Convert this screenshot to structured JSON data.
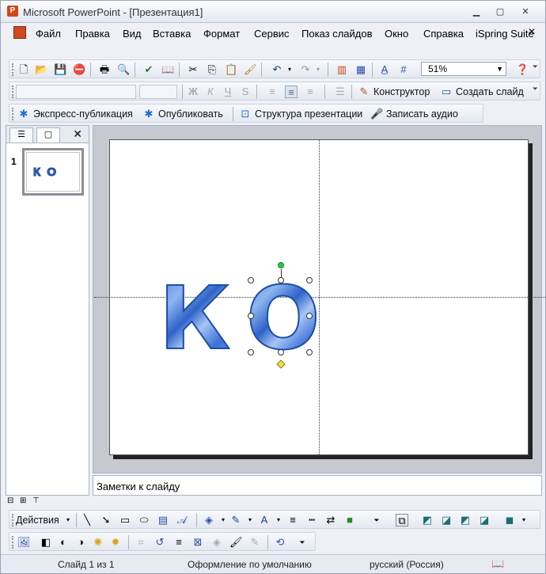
{
  "window": {
    "title": "Microsoft PowerPoint - [Презентация1]"
  },
  "menu": [
    "Файл",
    "Правка",
    "Вид",
    "Вставка",
    "Формат",
    "Сервис",
    "Показ слайдов",
    "Окно",
    "Справка",
    "iSpring Suite"
  ],
  "standard_toolbar": {
    "zoom": "51%"
  },
  "formatting_toolbar": {
    "design_label": "Конструктор",
    "new_slide_label": "Создать слайд"
  },
  "ispring_toolbar": {
    "quick_publish": "Экспресс-публикация",
    "publish": "Опубликовать",
    "structure": "Структура презентации",
    "record_audio": "Записать аудио"
  },
  "slides_pane": {
    "slide_number": "1",
    "thumb_text": "К О"
  },
  "slide": {
    "letter1": "К",
    "letter2": "О"
  },
  "notes": {
    "placeholder": "Заметки к слайду"
  },
  "drawing_toolbar": {
    "actions_label": "Действия"
  },
  "status": {
    "slide_info": "Слайд 1 из 1",
    "design": "Оформление по умолчанию",
    "language": "русский (Россия)"
  },
  "colors": {
    "accent": "#3a6fcf",
    "rotation_handle": "#2ecc40",
    "adjust_handle": "#f4e04a"
  }
}
